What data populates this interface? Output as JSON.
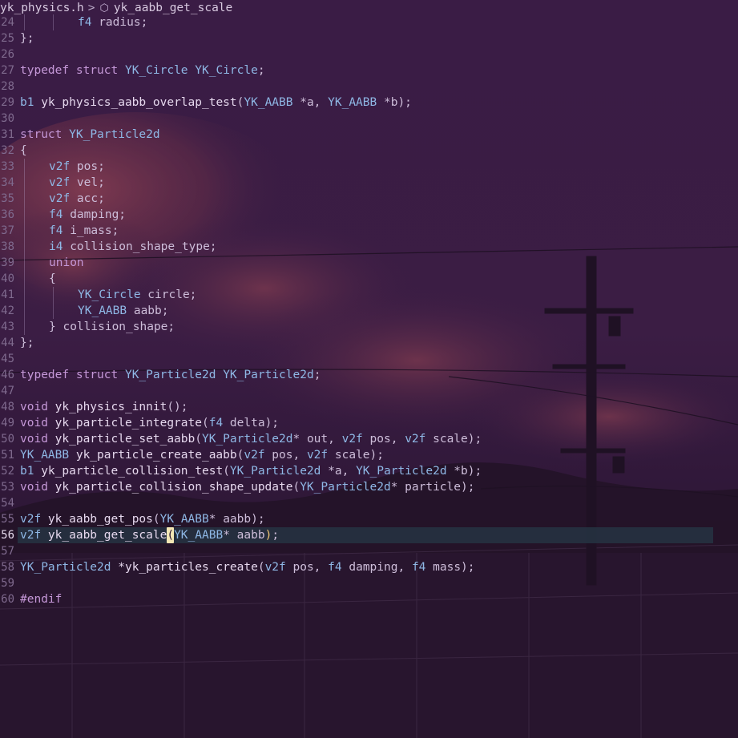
{
  "breadcrumb": {
    "file": "yk_physics.h",
    "separator": ">",
    "symbol_icon": "cube-icon",
    "symbol": "yk_aabb_get_scale"
  },
  "colors": {
    "background": "#2a1532",
    "keyword": "#c598d8",
    "type": "#8fb8e6",
    "text": "#cdbdd9",
    "line_number": "#7f6a8e",
    "current_line": "#263442",
    "cursor": "#f2e6b4"
  },
  "editor": {
    "current_line": "56",
    "lines": [
      {
        "n": "24",
        "indent": 2,
        "tokens": [
          [
            "ty",
            "f4"
          ],
          [
            "id",
            " radius;"
          ]
        ]
      },
      {
        "n": "25",
        "indent": 0,
        "tokens": [
          [
            "pu",
            "};"
          ]
        ]
      },
      {
        "n": "26",
        "indent": 0,
        "tokens": []
      },
      {
        "n": "27",
        "indent": 0,
        "tokens": [
          [
            "kw",
            "typedef"
          ],
          [
            "id",
            " "
          ],
          [
            "kw",
            "struct"
          ],
          [
            "id",
            " "
          ],
          [
            "ty",
            "YK_Circle"
          ],
          [
            "id",
            " "
          ],
          [
            "ty",
            "YK_Circle"
          ],
          [
            "pu",
            ";"
          ]
        ]
      },
      {
        "n": "28",
        "indent": 0,
        "tokens": []
      },
      {
        "n": "29",
        "indent": 0,
        "tokens": [
          [
            "ty",
            "b1"
          ],
          [
            "fn",
            " yk_physics_aabb_overlap_test"
          ],
          [
            "pu",
            "("
          ],
          [
            "ty",
            "YK_AABB"
          ],
          [
            "id",
            " *a, "
          ],
          [
            "ty",
            "YK_AABB"
          ],
          [
            "id",
            " *b);"
          ]
        ]
      },
      {
        "n": "30",
        "indent": 0,
        "tokens": []
      },
      {
        "n": "31",
        "indent": 0,
        "tokens": [
          [
            "kw",
            "struct"
          ],
          [
            "id",
            " "
          ],
          [
            "ty",
            "YK_Particle2d"
          ]
        ]
      },
      {
        "n": "32",
        "indent": 0,
        "tokens": [
          [
            "pu",
            "{"
          ]
        ]
      },
      {
        "n": "33",
        "indent": 1,
        "tokens": [
          [
            "ty",
            "v2f"
          ],
          [
            "id",
            " pos;"
          ]
        ]
      },
      {
        "n": "34",
        "indent": 1,
        "tokens": [
          [
            "ty",
            "v2f"
          ],
          [
            "id",
            " vel;"
          ]
        ]
      },
      {
        "n": "35",
        "indent": 1,
        "tokens": [
          [
            "ty",
            "v2f"
          ],
          [
            "id",
            " acc;"
          ]
        ]
      },
      {
        "n": "36",
        "indent": 1,
        "tokens": [
          [
            "ty",
            "f4"
          ],
          [
            "id",
            " damping;"
          ]
        ]
      },
      {
        "n": "37",
        "indent": 1,
        "tokens": [
          [
            "ty",
            "f4"
          ],
          [
            "id",
            " i_mass;"
          ]
        ]
      },
      {
        "n": "38",
        "indent": 1,
        "tokens": [
          [
            "ty",
            "i4"
          ],
          [
            "id",
            " collision_shape_type;"
          ]
        ]
      },
      {
        "n": "39",
        "indent": 1,
        "tokens": [
          [
            "kw",
            "union"
          ]
        ]
      },
      {
        "n": "40",
        "indent": 1,
        "tokens": [
          [
            "pu",
            "{"
          ]
        ]
      },
      {
        "n": "41",
        "indent": 2,
        "tokens": [
          [
            "ty",
            "YK_Circle"
          ],
          [
            "id",
            " circle;"
          ]
        ]
      },
      {
        "n": "42",
        "indent": 2,
        "tokens": [
          [
            "ty",
            "YK_AABB"
          ],
          [
            "id",
            " aabb;"
          ]
        ]
      },
      {
        "n": "43",
        "indent": 1,
        "tokens": [
          [
            "pu",
            "}"
          ],
          [
            "id",
            " collision_shape;"
          ]
        ]
      },
      {
        "n": "44",
        "indent": 0,
        "tokens": [
          [
            "pu",
            "};"
          ]
        ]
      },
      {
        "n": "45",
        "indent": 0,
        "tokens": []
      },
      {
        "n": "46",
        "indent": 0,
        "tokens": [
          [
            "kw",
            "typedef"
          ],
          [
            "id",
            " "
          ],
          [
            "kw",
            "struct"
          ],
          [
            "id",
            " "
          ],
          [
            "ty",
            "YK_Particle2d"
          ],
          [
            "id",
            " "
          ],
          [
            "ty",
            "YK_Particle2d"
          ],
          [
            "pu",
            ";"
          ]
        ]
      },
      {
        "n": "47",
        "indent": 0,
        "tokens": []
      },
      {
        "n": "48",
        "indent": 0,
        "tokens": [
          [
            "kw",
            "void"
          ],
          [
            "fn",
            " yk_physics_innit"
          ],
          [
            "pu",
            "();"
          ]
        ]
      },
      {
        "n": "49",
        "indent": 0,
        "tokens": [
          [
            "kw",
            "void"
          ],
          [
            "fn",
            " yk_particle_integrate"
          ],
          [
            "pu",
            "("
          ],
          [
            "ty",
            "f4"
          ],
          [
            "id",
            " delta);"
          ]
        ]
      },
      {
        "n": "50",
        "indent": 0,
        "tokens": [
          [
            "kw",
            "void"
          ],
          [
            "fn",
            " yk_particle_set_aabb"
          ],
          [
            "pu",
            "("
          ],
          [
            "ty",
            "YK_Particle2d"
          ],
          [
            "id",
            "* out, "
          ],
          [
            "ty",
            "v2f"
          ],
          [
            "id",
            " pos, "
          ],
          [
            "ty",
            "v2f"
          ],
          [
            "id",
            " scale);"
          ]
        ]
      },
      {
        "n": "51",
        "indent": 0,
        "tokens": [
          [
            "ty",
            "YK_AABB"
          ],
          [
            "fn",
            " yk_particle_create_aabb"
          ],
          [
            "pu",
            "("
          ],
          [
            "ty",
            "v2f"
          ],
          [
            "id",
            " pos, "
          ],
          [
            "ty",
            "v2f"
          ],
          [
            "id",
            " scale);"
          ]
        ]
      },
      {
        "n": "52",
        "indent": 0,
        "tokens": [
          [
            "ty",
            "b1"
          ],
          [
            "fn",
            " yk_particle_collision_test"
          ],
          [
            "pu",
            "("
          ],
          [
            "ty",
            "YK_Particle2d"
          ],
          [
            "id",
            " *a, "
          ],
          [
            "ty",
            "YK_Particle2d"
          ],
          [
            "id",
            " *b);"
          ]
        ]
      },
      {
        "n": "53",
        "indent": 0,
        "tokens": [
          [
            "kw",
            "void"
          ],
          [
            "fn",
            " yk_particle_collision_shape_update"
          ],
          [
            "pu",
            "("
          ],
          [
            "ty",
            "YK_Particle2d"
          ],
          [
            "id",
            "* particle);"
          ]
        ]
      },
      {
        "n": "54",
        "indent": 0,
        "tokens": []
      },
      {
        "n": "55",
        "indent": 0,
        "tokens": [
          [
            "ty",
            "v2f"
          ],
          [
            "fn",
            " yk_aabb_get_pos"
          ],
          [
            "pu",
            "("
          ],
          [
            "ty",
            "YK_AABB"
          ],
          [
            "id",
            "* aabb);"
          ]
        ]
      },
      {
        "n": "56",
        "indent": 0,
        "tokens": [
          [
            "ty",
            "v2f"
          ],
          [
            "fn",
            " yk_aabb_get_scale"
          ],
          [
            "cursor",
            "("
          ],
          [
            "ty",
            "YK_AABB"
          ],
          [
            "id",
            "* aabb"
          ],
          [
            "match",
            ")"
          ],
          [
            "pu",
            ";"
          ]
        ]
      },
      {
        "n": "57",
        "indent": 0,
        "tokens": []
      },
      {
        "n": "58",
        "indent": 0,
        "tokens": [
          [
            "ty",
            "YK_Particle2d"
          ],
          [
            "fn",
            " *yk_particles_create"
          ],
          [
            "pu",
            "("
          ],
          [
            "ty",
            "v2f"
          ],
          [
            "id",
            " pos, "
          ],
          [
            "ty",
            "f4"
          ],
          [
            "id",
            " damping, "
          ],
          [
            "ty",
            "f4"
          ],
          [
            "id",
            " mass);"
          ]
        ]
      },
      {
        "n": "59",
        "indent": 0,
        "tokens": []
      },
      {
        "n": "60",
        "indent": 0,
        "tokens": [
          [
            "pp",
            "#endif"
          ]
        ]
      }
    ]
  }
}
